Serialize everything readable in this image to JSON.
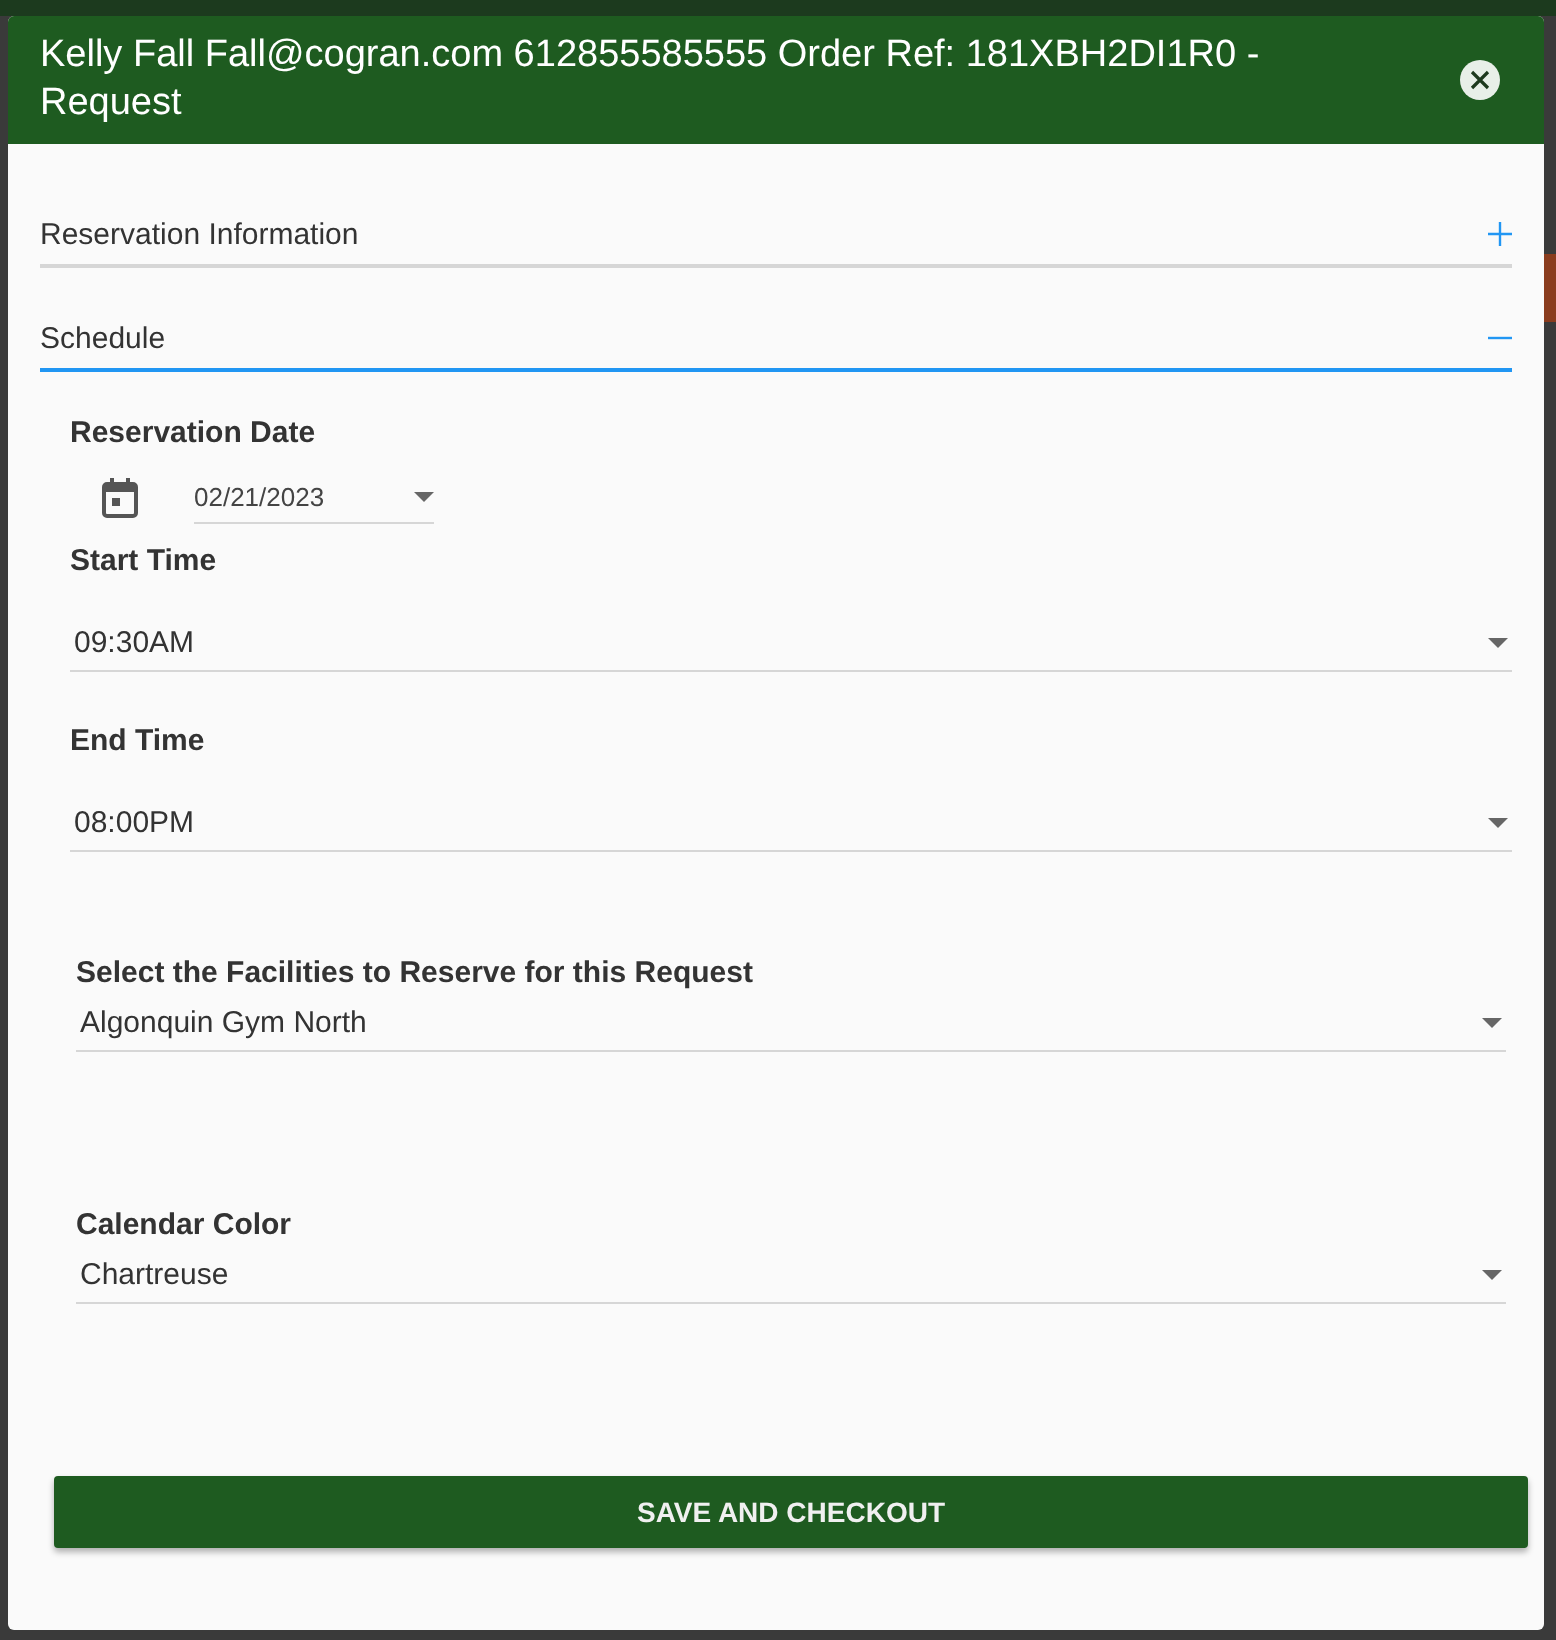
{
  "dialog": {
    "title": "Kelly Fall Fall@cogran.com 612855585555 Order Ref: 181XBH2DI1R0 - Request"
  },
  "sections": [
    {
      "label": "Reservation Information",
      "expanded": false
    },
    {
      "label": "Schedule",
      "expanded": true
    }
  ],
  "reservation_date": {
    "label": "Reservation Date",
    "value": "02/21/2023"
  },
  "fields": [
    {
      "label": "Start Time",
      "value": "09:30AM",
      "kind": "time"
    },
    {
      "label": "End Time",
      "value": "08:00PM",
      "kind": "time"
    },
    {
      "label": "Select the Facilities to Reserve for this Request",
      "value": "Algonquin Gym North",
      "kind": "select"
    },
    {
      "label": "Calendar Color",
      "value": "Chartreuse",
      "kind": "select"
    }
  ],
  "save_button": "SAVE AND CHECKOUT"
}
